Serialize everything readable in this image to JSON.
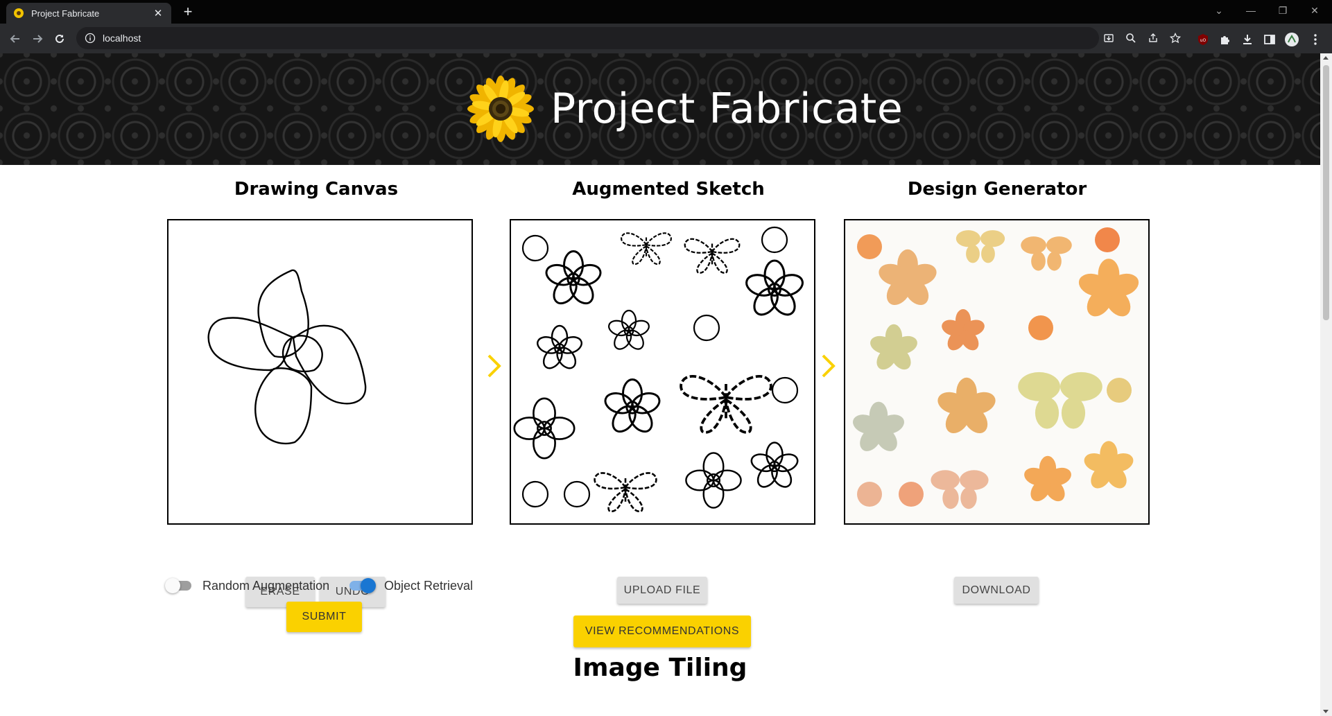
{
  "browser": {
    "tab_title": "Project Fabricate",
    "tab_close": "✕",
    "new_tab": "+",
    "url": "localhost",
    "window_controls": [
      "⌄",
      "—",
      "❐",
      "✕"
    ]
  },
  "header": {
    "title": "Project Fabricate",
    "logo_icon": "sunflower-logo"
  },
  "columns": {
    "drawing": {
      "title": "Drawing Canvas"
    },
    "augmented": {
      "title": "Augmented Sketch"
    },
    "generator": {
      "title": "Design Generator"
    }
  },
  "controls": {
    "erase_label": "ERASE",
    "undo_label": "UNDO",
    "random_augmentation_label": "Random Augmentation",
    "random_augmentation_on": false,
    "object_retrieval_label": "Object Retrieval",
    "object_retrieval_on": true,
    "submit_label": "SUBMIT",
    "upload_label": "UPLOAD FILE",
    "view_recommendations_label": "VIEW RECOMMENDATIONS",
    "download_label": "DOWNLOAD"
  },
  "sections": {
    "image_tiling_title": "Image Tiling"
  },
  "colors": {
    "accent_yellow": "#fad100",
    "toggle_blue": "#1976d2",
    "banner_dark": "#161616"
  }
}
